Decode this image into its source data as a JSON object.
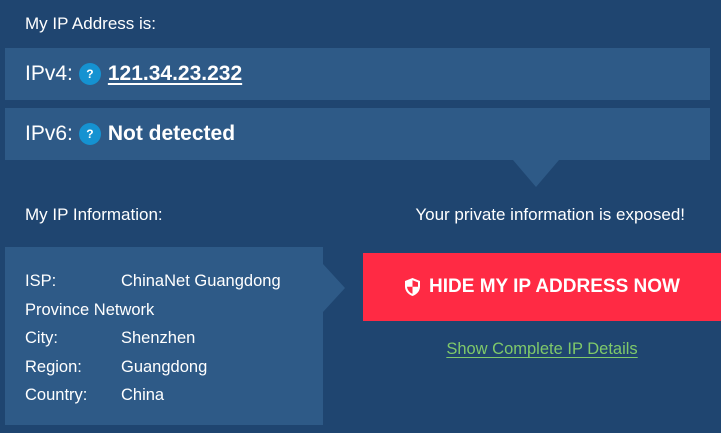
{
  "ip_section": {
    "heading": "My IP Address is:",
    "ipv4": {
      "label": "IPv4:",
      "help": "?",
      "value": "121.34.23.232"
    },
    "ipv6": {
      "label": "IPv6:",
      "help": "?",
      "value": "Not detected"
    }
  },
  "info_section": {
    "heading": "My IP Information:",
    "isp": {
      "label": "ISP:",
      "value": "ChinaNet Guangdong",
      "value_cont": "Province Network"
    },
    "city": {
      "label": "City:",
      "value": "Shenzhen"
    },
    "region": {
      "label": "Region:",
      "value": "Guangdong"
    },
    "country": {
      "label": "Country:",
      "value": "China"
    }
  },
  "action": {
    "warning": "Your private information is exposed!",
    "hide_button": "HIDE MY IP ADDRESS NOW",
    "details_link": "Show Complete IP Details",
    "icon": "shield-icon"
  },
  "colors": {
    "background": "#1f4570",
    "panel": "#2e5a87",
    "help_icon": "#1592d1",
    "button": "#ff2a44",
    "link": "#7fc96a"
  }
}
